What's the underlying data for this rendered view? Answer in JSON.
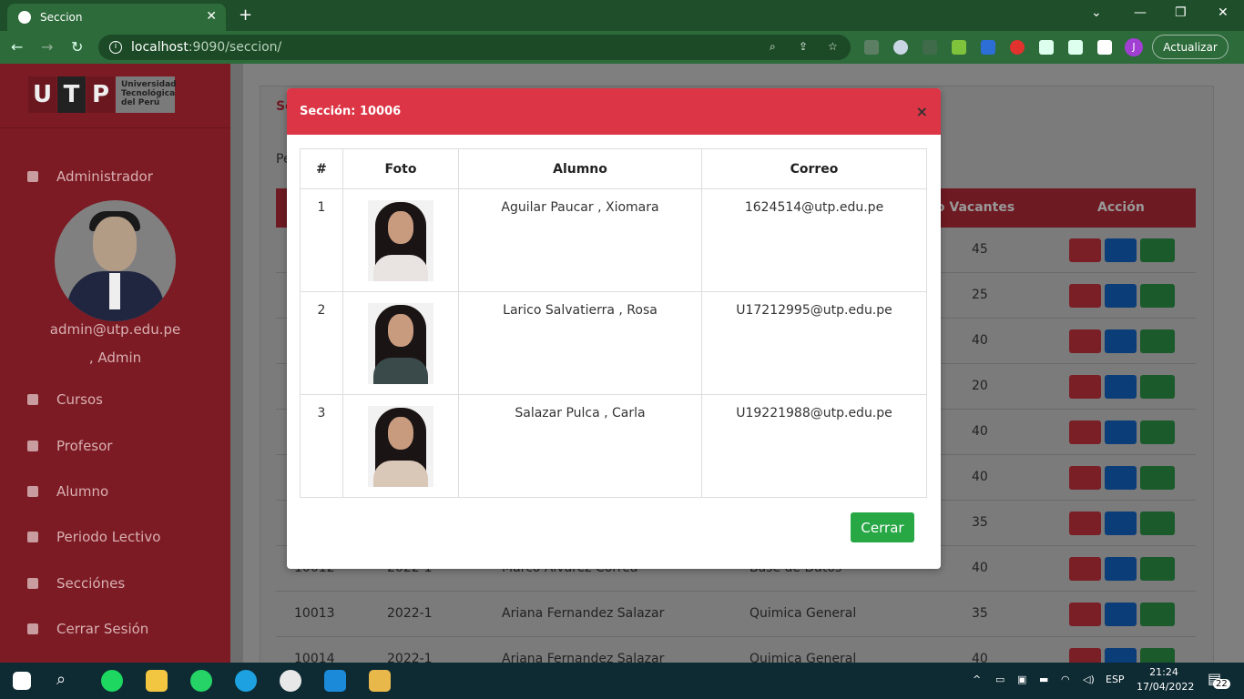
{
  "browser": {
    "tab_title": "Seccion",
    "url_host": "localhost",
    "url_port_path": ":9090/seccion/",
    "update_button": "Actualizar",
    "profile_initial": "J"
  },
  "sidebar": {
    "logo_letters": [
      "U",
      "T",
      "P"
    ],
    "logo_text": "Universidad Tecnológica del Perú",
    "user_role": "Administrador",
    "user_email": "admin@utp.edu.pe",
    "user_name": ", Admin",
    "items": [
      {
        "label": "Cursos"
      },
      {
        "label": "Profesor"
      },
      {
        "label": "Alumno"
      },
      {
        "label": "Periodo Lectivo"
      },
      {
        "label": "Secciónes"
      },
      {
        "label": "Cerrar Sesión"
      }
    ]
  },
  "background": {
    "card_title_prefix": "Se",
    "filter_prefix": "Pe",
    "header_vacantes": "ro Vacantes",
    "header_accion": "Acción",
    "rows": [
      {
        "code": "",
        "period": "",
        "teacher": "",
        "course": "",
        "vacantes": "45"
      },
      {
        "code": "",
        "period": "",
        "teacher": "",
        "course": "",
        "vacantes": "25"
      },
      {
        "code": "",
        "period": "",
        "teacher": "",
        "course": "",
        "vacantes": "40"
      },
      {
        "code": "",
        "period": "",
        "teacher": "",
        "course": "",
        "vacantes": "20"
      },
      {
        "code": "",
        "period": "",
        "teacher": "",
        "course": "",
        "vacantes": "40"
      },
      {
        "code": "",
        "period": "",
        "teacher": "",
        "course": "",
        "vacantes": "40"
      },
      {
        "code": "",
        "period": "",
        "teacher": "",
        "course": "",
        "vacantes": "35"
      },
      {
        "code": "10012",
        "period": "2022-1",
        "teacher": "Marco Alvarez Correa",
        "course": "Base de Datos",
        "vacantes": "40"
      },
      {
        "code": "10013",
        "period": "2022-1",
        "teacher": "Ariana Fernandez Salazar",
        "course": "Quimica General",
        "vacantes": "35"
      },
      {
        "code": "10014",
        "period": "2022-1",
        "teacher": "Ariana Fernandez Salazar",
        "course": "Quimica General",
        "vacantes": "40"
      }
    ]
  },
  "modal": {
    "title": "Sección: 10006",
    "close_symbol": "×",
    "headers": [
      "#",
      "Foto",
      "Alumno",
      "Correo"
    ],
    "students": [
      {
        "num": "1",
        "name": "Aguilar Paucar , Xiomara",
        "email": "1624514@utp.edu.pe"
      },
      {
        "num": "2",
        "name": "Larico Salvatierra , Rosa",
        "email": "U17212995@utp.edu.pe"
      },
      {
        "num": "3",
        "name": "Salazar Pulca , Carla",
        "email": "U19221988@utp.edu.pe"
      }
    ],
    "close_button": "Cerrar"
  },
  "taskbar": {
    "language": "ESP",
    "time": "21:24",
    "date": "17/04/2022",
    "notifications": "22"
  },
  "colors": {
    "modal_header": "#dc3545",
    "close_button": "#28a745",
    "sidebar": "#7c1b23"
  }
}
